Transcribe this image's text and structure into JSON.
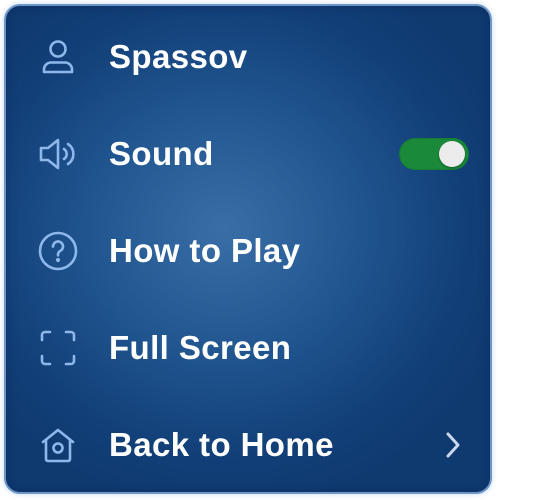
{
  "menu": {
    "items": [
      {
        "label": "Spassov",
        "icon": "user-icon"
      },
      {
        "label": "Sound",
        "icon": "speaker-icon",
        "toggle_on": true
      },
      {
        "label": "How to Play",
        "icon": "help-circle-icon"
      },
      {
        "label": "Full Screen",
        "icon": "fullscreen-icon"
      },
      {
        "label": "Back to Home",
        "icon": "home-icon",
        "chevron": "chevron-right-icon"
      }
    ]
  },
  "colors": {
    "panel_center": "#3a6ea7",
    "panel_edge": "#0f3a70",
    "icon": "#8eb8ec",
    "toggle_on": "#1a8a3a",
    "text": "#ffffff"
  }
}
